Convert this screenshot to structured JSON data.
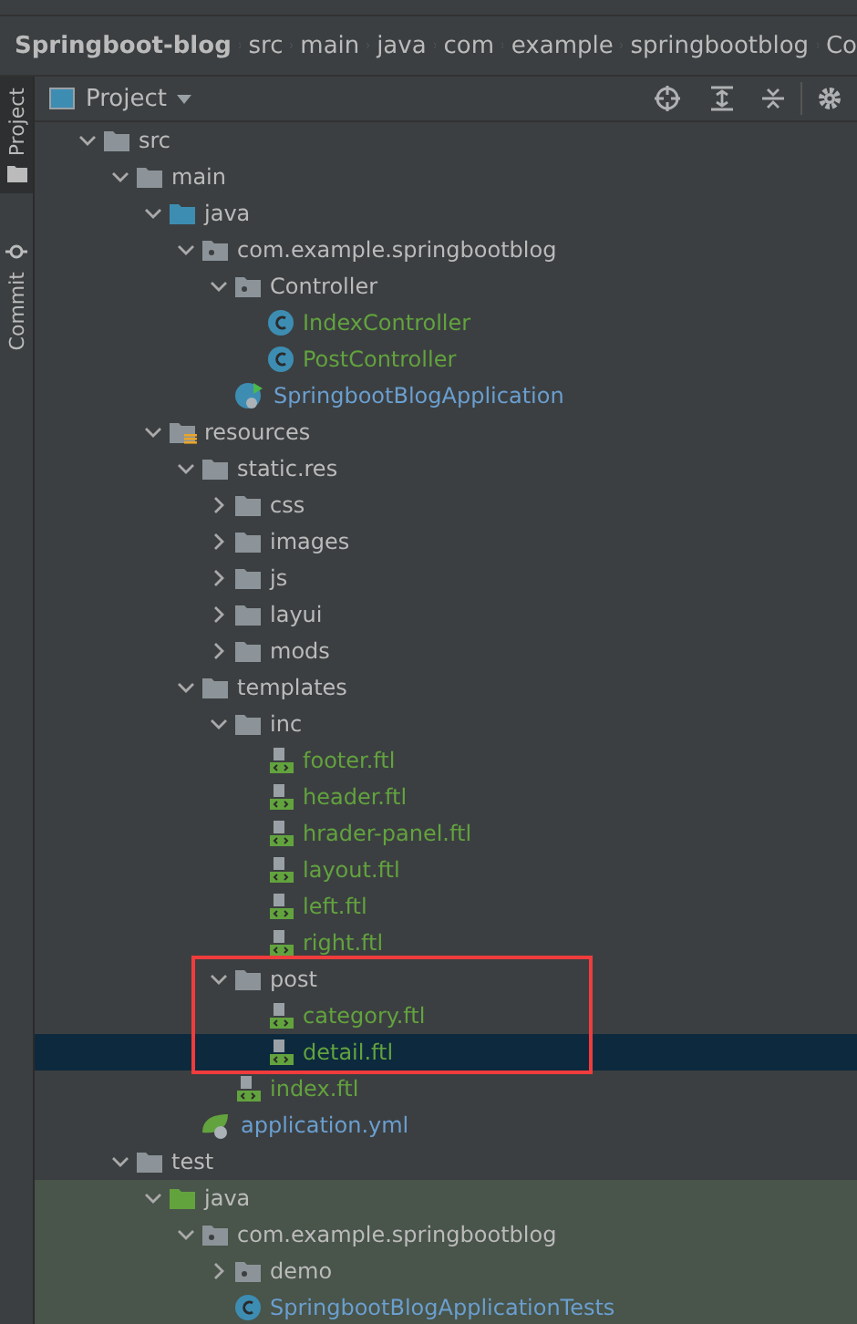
{
  "breadcrumbs": [
    "Springboot-blog",
    "src",
    "main",
    "java",
    "com",
    "example",
    "springbootblog",
    "Co"
  ],
  "left_tabs": [
    {
      "label": "Project",
      "selected": true
    },
    {
      "label": "Commit",
      "selected": false
    }
  ],
  "panel": {
    "title": "Project"
  },
  "tree": [
    {
      "label": "src",
      "kind": "folder",
      "expanded": true,
      "children": [
        {
          "label": "main",
          "kind": "folder",
          "expanded": true,
          "children": [
            {
              "label": "java",
              "kind": "source",
              "expanded": true,
              "children": [
                {
                  "label": "com.example.springbootblog",
                  "kind": "package",
                  "expanded": true,
                  "children": [
                    {
                      "label": "Controller",
                      "kind": "package",
                      "expanded": true,
                      "children": [
                        {
                          "label": "IndexController",
                          "kind": "class",
                          "color": "#62a33e"
                        },
                        {
                          "label": "PostController",
                          "kind": "class",
                          "color": "#62a33e"
                        }
                      ]
                    },
                    {
                      "label": "SpringbootBlogApplication",
                      "kind": "app",
                      "color": "#6a9fd0"
                    }
                  ]
                }
              ]
            },
            {
              "label": "resources",
              "kind": "resources",
              "expanded": true,
              "children": [
                {
                  "label": "static.res",
                  "kind": "folder",
                  "expanded": true,
                  "children": [
                    {
                      "label": "css",
                      "kind": "folder",
                      "expanded": false
                    },
                    {
                      "label": "images",
                      "kind": "folder",
                      "expanded": false
                    },
                    {
                      "label": "js",
                      "kind": "folder",
                      "expanded": false
                    },
                    {
                      "label": "layui",
                      "kind": "folder",
                      "expanded": false
                    },
                    {
                      "label": "mods",
                      "kind": "folder",
                      "expanded": false
                    }
                  ]
                },
                {
                  "label": "templates",
                  "kind": "folder",
                  "expanded": true,
                  "children": [
                    {
                      "label": "inc",
                      "kind": "folder",
                      "expanded": true,
                      "children": [
                        {
                          "label": "footer.ftl",
                          "kind": "ftl",
                          "color": "#62a33e"
                        },
                        {
                          "label": "header.ftl",
                          "kind": "ftl",
                          "color": "#62a33e"
                        },
                        {
                          "label": "hrader-panel.ftl",
                          "kind": "ftl",
                          "color": "#62a33e"
                        },
                        {
                          "label": "layout.ftl",
                          "kind": "ftl",
                          "color": "#62a33e"
                        },
                        {
                          "label": "left.ftl",
                          "kind": "ftl",
                          "color": "#62a33e"
                        },
                        {
                          "label": "right.ftl",
                          "kind": "ftl",
                          "color": "#62a33e"
                        }
                      ]
                    },
                    {
                      "label": "post",
                      "kind": "folder",
                      "expanded": true,
                      "marked": true,
                      "children": [
                        {
                          "label": "category.ftl",
                          "kind": "ftl",
                          "color": "#62a33e"
                        },
                        {
                          "label": "detail.ftl",
                          "kind": "ftl",
                          "color": "#62a33e",
                          "selected": true
                        }
                      ]
                    },
                    {
                      "label": "index.ftl",
                      "kind": "ftl",
                      "color": "#62a33e"
                    }
                  ]
                },
                {
                  "label": "application.yml",
                  "kind": "yml",
                  "color": "#6a9fd0"
                }
              ]
            }
          ]
        },
        {
          "label": "test",
          "kind": "folder",
          "expanded": true,
          "children": [
            {
              "label": "java",
              "kind": "test",
              "expanded": true,
              "tinted": true,
              "children": [
                {
                  "label": "com.example.springbootblog",
                  "kind": "package",
                  "expanded": true,
                  "tinted": true,
                  "children": [
                    {
                      "label": "demo",
                      "kind": "package",
                      "expanded": false,
                      "tinted": true
                    },
                    {
                      "label": "SpringbootBlogApplicationTests",
                      "kind": "class",
                      "color": "#6a9fd0",
                      "tinted": true
                    }
                  ]
                }
              ]
            }
          ]
        }
      ]
    }
  ]
}
